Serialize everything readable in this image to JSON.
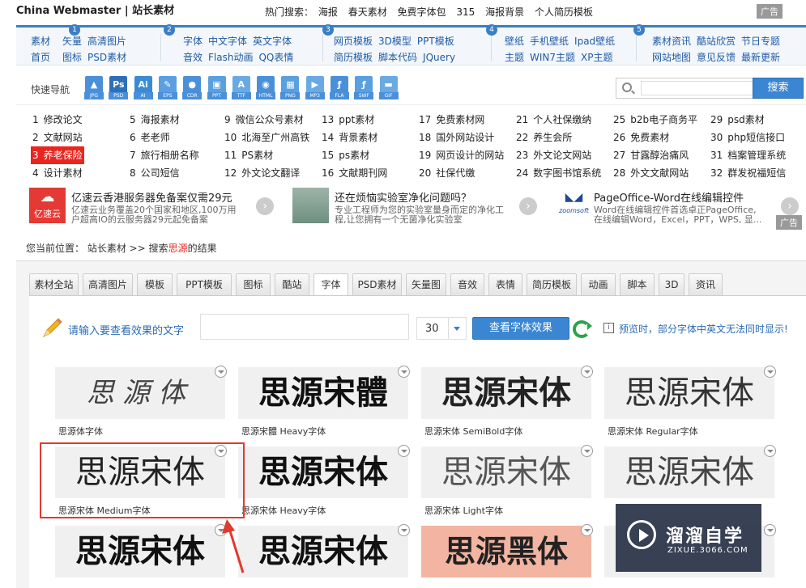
{
  "topbar": {
    "logo": "China Webmaster | 站长素材",
    "hot_label": "热门搜索：",
    "hot_terms": [
      "海报",
      "春天素材",
      "免费字体包",
      "315",
      "海报背景",
      "个人简历模板"
    ],
    "ad": "广告"
  },
  "nav": {
    "groups": [
      {
        "num": "1",
        "row1": [
          "素材",
          "矢量",
          "高清图片"
        ],
        "row2": [
          "首页",
          "图标",
          "PSD素材"
        ]
      },
      {
        "num": "2",
        "row1": [
          "字体",
          "中文字体",
          "英文字体"
        ],
        "row2": [
          "音效",
          "Flash动画",
          "QQ表情"
        ]
      },
      {
        "num": "3",
        "row1": [
          "网页模板",
          "3D模型",
          "PPT模板"
        ],
        "row2": [
          "简历模板",
          "脚本代码",
          "JQuery"
        ]
      },
      {
        "num": "4",
        "row1": [
          "壁纸",
          "手机壁纸",
          "Ipad壁纸"
        ],
        "row2": [
          "主题",
          "WIN7主题",
          "XP主题"
        ]
      },
      {
        "num": "5",
        "row1": [
          "素材资讯",
          "酷站欣赏",
          "节日专题"
        ],
        "row2": [
          "网站地图",
          "意见反馈",
          "最新更新"
        ]
      }
    ]
  },
  "quick": {
    "label": "快速导航",
    "icons": [
      {
        "name": "jpg-icon",
        "label": "JPG",
        "color": "#4a90d9",
        "glyph": "▲"
      },
      {
        "name": "psd-icon",
        "label": "PSD",
        "color": "#2e6fb8",
        "glyph": "Ps"
      },
      {
        "name": "ai-icon",
        "label": "AI",
        "color": "#3a8ad6",
        "glyph": "Ai"
      },
      {
        "name": "eps-icon",
        "label": "EPS",
        "color": "#5aa0e0",
        "glyph": "✎"
      },
      {
        "name": "cdr-icon",
        "label": "CDR",
        "color": "#4a90d9",
        "glyph": "●"
      },
      {
        "name": "ppt-icon",
        "label": "PPT",
        "color": "#5aa0e0",
        "glyph": "▣"
      },
      {
        "name": "ttf-icon",
        "label": "TTF",
        "color": "#6aaae4",
        "glyph": "A"
      },
      {
        "name": "html-icon",
        "label": "HTML",
        "color": "#4a90d9",
        "glyph": "◉"
      },
      {
        "name": "png-icon",
        "label": "PNG",
        "color": "#5aa0e0",
        "glyph": "▦"
      },
      {
        "name": "mp3-icon",
        "label": "MP3",
        "color": "#6aaae4",
        "glyph": "▶"
      },
      {
        "name": "fla-icon",
        "label": "FLA",
        "color": "#4a90d9",
        "glyph": "ƒ"
      },
      {
        "name": "swf-icon",
        "label": "SWF",
        "color": "#5aa0e0",
        "glyph": "ƒ"
      },
      {
        "name": "gif-icon",
        "label": "GIF",
        "color": "#6aaae4",
        "glyph": "▬"
      }
    ],
    "search_button": "搜索"
  },
  "links": [
    {
      "n": "1",
      "t": "修改论文"
    },
    {
      "n": "5",
      "t": "海报素材"
    },
    {
      "n": "9",
      "t": "微信公众号素材"
    },
    {
      "n": "13",
      "t": "ppt素材"
    },
    {
      "n": "17",
      "t": "免费素材网"
    },
    {
      "n": "21",
      "t": "个人社保缴纳"
    },
    {
      "n": "25",
      "t": "b2b电子商务平"
    },
    {
      "n": "29",
      "t": "psd素材"
    },
    {
      "n": "2",
      "t": "文献网站"
    },
    {
      "n": "6",
      "t": "老老师"
    },
    {
      "n": "10",
      "t": "北海至广州高铁"
    },
    {
      "n": "14",
      "t": "背景素材"
    },
    {
      "n": "18",
      "t": "国外网站设计"
    },
    {
      "n": "22",
      "t": "养生会所"
    },
    {
      "n": "26",
      "t": "免费素材"
    },
    {
      "n": "30",
      "t": "php短信接口"
    },
    {
      "n": "3",
      "t": "养老保险"
    },
    {
      "n": "7",
      "t": "旅行相册名称"
    },
    {
      "n": "11",
      "t": "PS素材"
    },
    {
      "n": "15",
      "t": "ps素材"
    },
    {
      "n": "19",
      "t": "网页设计的网站"
    },
    {
      "n": "23",
      "t": "外文论文网站"
    },
    {
      "n": "27",
      "t": "甘露醇治痛风"
    },
    {
      "n": "31",
      "t": "档案管理系统"
    },
    {
      "n": "4",
      "t": "设计素材"
    },
    {
      "n": "8",
      "t": "公司短信"
    },
    {
      "n": "12",
      "t": "外文论文翻译"
    },
    {
      "n": "16",
      "t": "文献期刊网"
    },
    {
      "n": "20",
      "t": "社保代缴"
    },
    {
      "n": "24",
      "t": "数字图书馆系统"
    },
    {
      "n": "28",
      "t": "外文文献网站"
    },
    {
      "n": "32",
      "t": "群发祝福短信"
    }
  ],
  "ads": [
    {
      "brand": "亿速云",
      "title": "亿速云香港服务器免备案仅需29元",
      "d1": "亿速云业务覆盖20个国家和地区,100万用",
      "d2": "户超高IO的云服务器29元起免备案"
    },
    {
      "title": "还在烦恼实验室净化问题吗？",
      "d1": "专业工程师为您的实验室量身而定的净化工",
      "d2": "程,让您拥有一个无菌净化实验室"
    },
    {
      "brand": "zoomsoft",
      "title": "PageOffice-Word在线编辑控件",
      "d1": "Word在线编辑控件首选卓正PageOffice,",
      "d2": "在线编辑Word，Excel，PPT，WPS, 显..."
    }
  ],
  "ad_tag": "广告",
  "breadcrumb": {
    "prefix": "您当前位置： 站长素材 >> 搜索",
    "keyword": "思源",
    "suffix": "的结果"
  },
  "tabs": [
    "素材全站",
    "高清图片",
    "模板",
    "PPT模板",
    "图标",
    "酷站",
    "字体",
    "PSD素材",
    "矢量图",
    "音效",
    "表情",
    "简历模板",
    "动画",
    "脚本",
    "3D",
    "资讯"
  ],
  "active_tab": "字体",
  "preview": {
    "prompt": "请输入要查看效果的文字",
    "size": "30",
    "button": "查看字体效果",
    "note": "预览时，部分字体中英文无法同时显示!"
  },
  "fonts": [
    {
      "text": "思源体",
      "name": "思源体字体"
    },
    {
      "text": "思源宋體",
      "name": "思源宋體 Heavy字体"
    },
    {
      "text": "思源宋体",
      "name": "思源宋体 SemiBold字体"
    },
    {
      "text": "思源宋体",
      "name": "思源宋体 Regular字体"
    },
    {
      "text": "思源宋体",
      "name": "思源宋体 Medium字体"
    },
    {
      "text": "思源宋体",
      "name": "思源宋体 Heavy字体"
    },
    {
      "text": "思源宋体",
      "name": "思源宋体 Light字体"
    },
    {
      "text": "思源宋体",
      "name": ""
    },
    {
      "text": "思源宋体",
      "name": ""
    },
    {
      "text": "思源宋体",
      "name": ""
    },
    {
      "text": "思源黑体",
      "name": ""
    },
    {
      "text": "",
      "name": ""
    }
  ],
  "watermark": {
    "title": "溜溜自学",
    "url": "ZIXUE.3066.COM"
  }
}
